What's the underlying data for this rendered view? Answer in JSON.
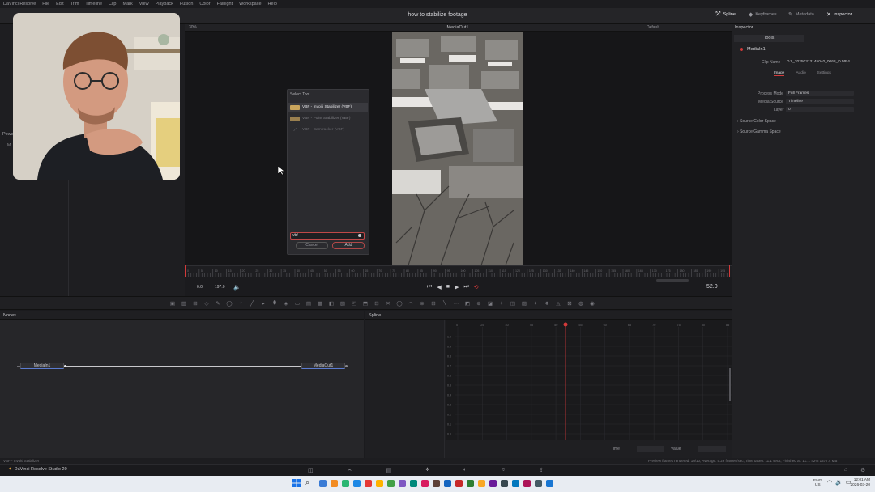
{
  "menubar": {
    "app_name": "DaVinci Resolve",
    "items": [
      "File",
      "Edit",
      "Trim",
      "Timeline",
      "Clip",
      "Mark",
      "View",
      "Playback",
      "Fusion",
      "Color",
      "Fairlight",
      "Workspace",
      "Help"
    ]
  },
  "toolbar": {
    "project_title": "how to stabilize footage",
    "spline_label": "Spline",
    "keyframes_label": "Keyframes",
    "metadata_label": "Metadata",
    "inspector_label": "Inspector"
  },
  "left_panel": {
    "fusion_label": "Powe",
    "fusion_sub": "M"
  },
  "viewer": {
    "zoom": "30%",
    "title": "MediaOut1",
    "view_mode": "Default",
    "timecode_start": "0.0",
    "timecode_end": "197.0",
    "current_frame": "52.0",
    "ruler_ticks": [
      "0",
      "5",
      "10",
      "15",
      "20",
      "25",
      "30",
      "35",
      "40",
      "45",
      "50",
      "55",
      "60",
      "65",
      "70",
      "75",
      "80",
      "85",
      "90",
      "95",
      "100",
      "105",
      "110",
      "115",
      "120",
      "125",
      "130",
      "135",
      "140",
      "145",
      "150",
      "155",
      "160",
      "165",
      "170",
      "175",
      "180",
      "185",
      "190",
      "195"
    ]
  },
  "dialog": {
    "title": "Select Tool",
    "items": [
      {
        "label": "VBF - Invoiti Stabilizer (VBF)"
      },
      {
        "label": "VBF - Point Stabilizer (VBF)"
      },
      {
        "label": "VBF - Camtracker (VBF)"
      }
    ],
    "search_value": "vbf",
    "cancel_label": "Cancel",
    "add_label": "Add"
  },
  "inspector": {
    "header": "Inspector",
    "tools_tab": "Tools",
    "node_name": "MediaIn1",
    "clip_name_label": "Clip Name",
    "clip_name_value": "DJI_20250313145040_0068_D.MP4",
    "tabs": [
      "Image",
      "Audio",
      "Settings"
    ],
    "process_mode_label": "Process Mode",
    "process_mode_value": "Full Frames",
    "media_source_label": "Media Source",
    "media_source_value": "Timeline",
    "layer_label": "Layer",
    "layer_value": "0",
    "source_color_space": "Source Color Space",
    "source_gamma_space": "Source Gamma Space"
  },
  "nodes": {
    "header": "Nodes",
    "media_in": "MediaIn1",
    "media_out": "MediaOut1"
  },
  "spline": {
    "header": "Spline",
    "time_label": "Time",
    "value_label": "Value",
    "x_ticks": [
      "0",
      "25",
      "40",
      "45",
      "50",
      "55",
      "60",
      "65",
      "70",
      "75",
      "80",
      "85"
    ],
    "y_ticks": [
      "1.0",
      "0.9",
      "0.8",
      "0.7",
      "0.6",
      "0.5",
      "0.4",
      "0.3",
      "0.2",
      "0.1",
      "0.0"
    ]
  },
  "status_bar": {
    "left_text": "VBF - Invoiti Stabilizer",
    "right_text": "Preview frames rendered: 10/10, Average: 5.29 frames/sec, Time taken: 11.1 secs, Finished at: 11:...   42%   1377.4 MB"
  },
  "page_bar": {
    "app_label": "DaVinci Resolve Studio 20"
  },
  "taskbar": {
    "lang": "ENG",
    "region": "US",
    "time": "12:01 AM",
    "date": "2026-03-20"
  },
  "colors": {
    "accent_red": "#d33a3a",
    "selection_blue": "#5b7bd0",
    "tool_gold": "#c9a45c"
  }
}
